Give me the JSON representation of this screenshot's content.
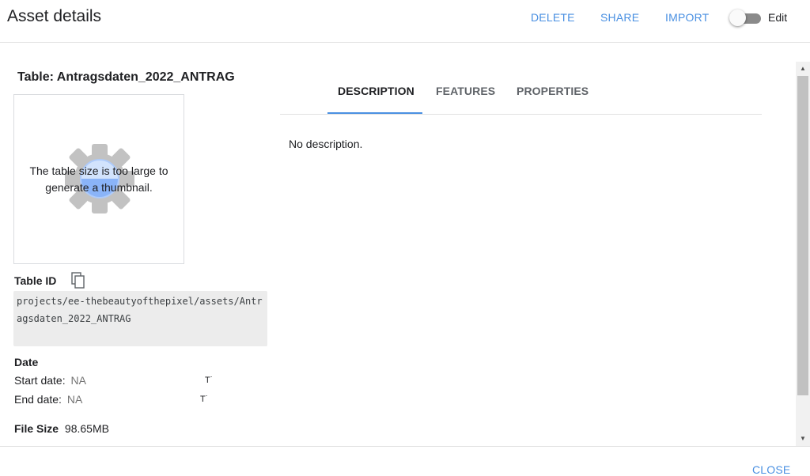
{
  "header": {
    "title": "Asset details",
    "delete_label": "DELETE",
    "share_label": "SHARE",
    "import_label": "IMPORT",
    "edit_toggle": {
      "label": "Edit",
      "on": false
    }
  },
  "asset": {
    "title": "Table: Antragsdaten_2022_ANTRAG",
    "thumbnail_message": "The table size is too large to generate a thumbnail.",
    "table_id_label": "Table ID",
    "table_id_value": "projects/ee-thebeautyofthepixel/assets/Antragsdaten_2022_ANTRAG",
    "date_label": "Date",
    "start_date_label": "Start date:",
    "start_date_value": "NA",
    "end_date_label": "End date:",
    "end_date_value": "NA",
    "date_caret": "T˙",
    "file_size_label": "File Size",
    "file_size_value": "98.65MB"
  },
  "tabs": [
    {
      "label": "DESCRIPTION",
      "active": true
    },
    {
      "label": "FEATURES",
      "active": false
    },
    {
      "label": "PROPERTIES",
      "active": false
    }
  ],
  "description_text": "No description.",
  "footer": {
    "close_label": "CLOSE"
  },
  "colors": {
    "accent": "#4a90e2",
    "toggle_off_track": "#8a8a8a",
    "id_box_bg": "#ececec",
    "icon_gray": "#c2c2c2",
    "icon_blue": "#8ab4f8"
  }
}
